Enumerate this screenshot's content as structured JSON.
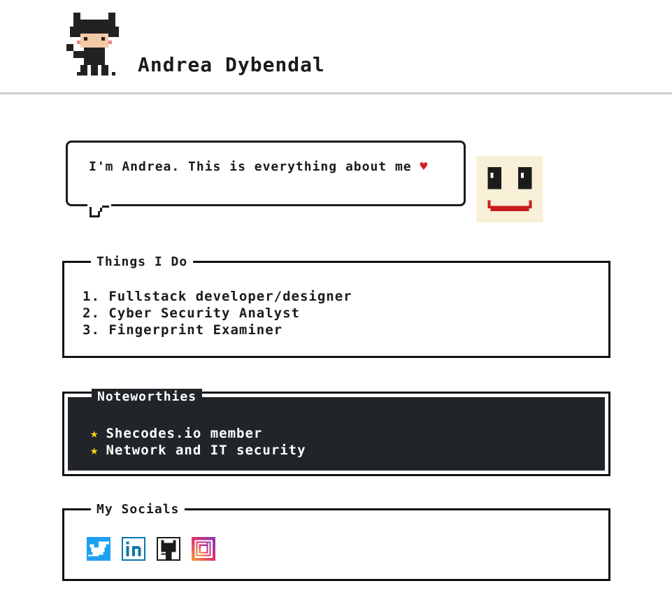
{
  "header": {
    "title": "Andrea Dybendal",
    "logo_icon": "octocat-pixel-icon"
  },
  "intro": {
    "bubble_text": "I'm Andrea. This is everything about me",
    "heart": "♥",
    "avatar_icon": "pixel-smiley-icon"
  },
  "things": {
    "title": "Things I Do",
    "items": [
      "1. Fullstack developer/designer",
      "2. Cyber Security Analyst",
      "3. Fingerprint Examiner"
    ]
  },
  "noteworthies": {
    "title": "Noteworthies",
    "star": "★",
    "items": [
      "Shecodes.io member",
      "Network and IT security"
    ]
  },
  "socials": {
    "title": "My Socials",
    "links": [
      "twitter-icon",
      "linkedin-icon",
      "github-icon",
      "instagram-icon"
    ]
  },
  "colors": {
    "heart": "#d42020",
    "star": "#f7d51d",
    "dark_box": "#212529",
    "twitter": "#1da1f2",
    "linkedin": "#0e76a8"
  }
}
